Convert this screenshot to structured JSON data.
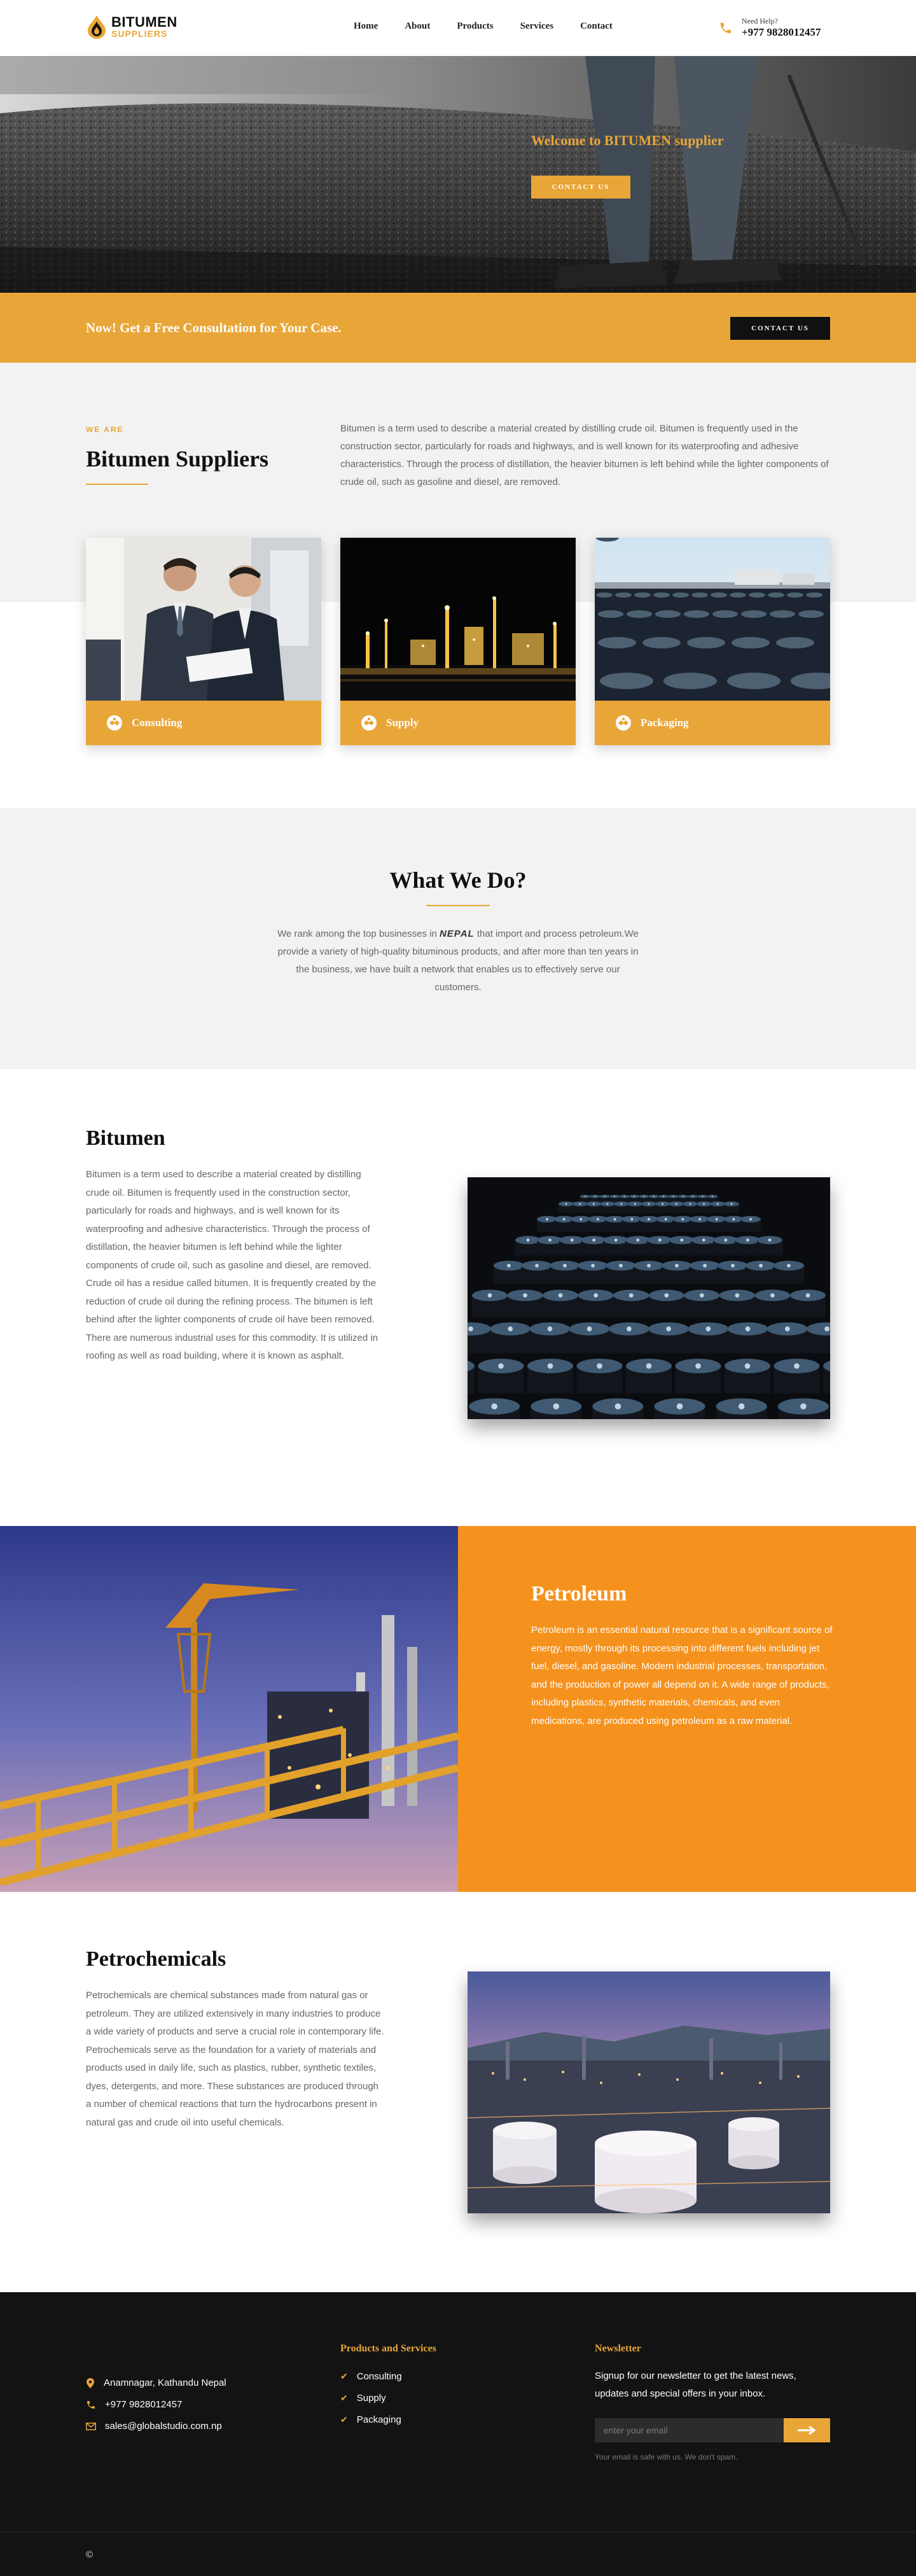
{
  "header": {
    "logo_main": "BITUMEN",
    "logo_sub": "SUPPLIERS",
    "nav": [
      "Home",
      "About",
      "Products",
      "Services",
      "Contact"
    ],
    "help_label": "Need Help?",
    "help_phone": "+977 9828012457"
  },
  "hero": {
    "title": "Welcome to BITUMEN supplier",
    "button": "CONTACT US"
  },
  "band": {
    "text": "Now! Get a Free Consultation for Your Case.",
    "button": "CONTACT US"
  },
  "about": {
    "eyebrow": "WE ARE",
    "title": "Bitumen Suppliers",
    "text": "Bitumen is a term used to describe a material created by distilling crude oil. Bitumen is frequently used in the construction sector, particularly for roads and highways, and is well known for its waterproofing and adhesive characteristics. Through the process of distillation, the heavier bitumen is left behind while the lighter components of crude oil, such as gasoline and diesel, are removed."
  },
  "cards": [
    {
      "label": "Consulting",
      "icon": "handshake-icon"
    },
    {
      "label": "Supply",
      "icon": "handshake-icon"
    },
    {
      "label": "Packaging",
      "icon": "handshake-icon"
    }
  ],
  "what": {
    "title": "What We Do?",
    "text_before": "We rank among the top businesses in ",
    "highlight": "NEPAL",
    "text_after": " that import and process petroleum.We provide a variety of high-quality bituminous products, and after more than ten years in the business, we have built a network that enables us to effectively serve our customers."
  },
  "bitumen": {
    "title": "Bitumen",
    "text": "Bitumen is a term used to describe a material created by distilling crude oil. Bitumen is frequently used in the construction sector, particularly for roads and highways, and is well known for its waterproofing and adhesive characteristics. Through the process of distillation, the heavier bitumen is left behind while the lighter components of crude oil, such as gasoline and diesel, are removed. Crude oil has a residue called bitumen. It is frequently created by the reduction of crude oil during the refining process. The bitumen is left behind after the lighter components of crude oil have been removed. There are numerous industrial uses for this commodity. It is utilized in roofing as well as road building, where it is known as asphalt."
  },
  "petroleum": {
    "title": "Petroleum",
    "text": "Petroleum is an essential natural resource that is a significant source of energy, mostly through its processing into different fuels including jet fuel, diesel, and gasoline. Modern industrial processes, transportation, and the production of power all depend on it. A wide range of products, including plastics, synthetic materials, chemicals, and even medications, are produced using petroleum as a raw material."
  },
  "petrochemicals": {
    "title": "Petrochemicals",
    "text": "Petrochemicals are chemical substances made from natural gas or petroleum. They are utilized extensively in many industries to produce a wide variety of products and serve a crucial role in contemporary life. Petrochemicals serve as the foundation for a variety of materials and products used in daily life, such as plastics, rubber, synthetic textiles, dyes, detergents, and more. These substances are produced through a number of chemical reactions that turn the hydrocarbons present in natural gas and crude oil into useful chemicals."
  },
  "footer": {
    "address": "Anamnagar, Kathandu Nepal",
    "phone": "+977 9828012457",
    "email": "sales@globalstudio.com.np",
    "products_heading": "Products and Services",
    "products": [
      "Consulting",
      "Supply",
      "Packaging"
    ],
    "newsletter_heading": "Newsletter",
    "newsletter_text": "Signup for our newsletter to get the latest news, updates and special offers in your inbox.",
    "newsletter_placeholder": "enter your email",
    "newsletter_note": "Your email is safe with us. We don't spam.",
    "copyright": "©"
  },
  "colors": {
    "accent": "#e9a638",
    "petroleum_bg": "#f5921e",
    "footer_bg": "#131313",
    "light_bg": "#f2f2f2"
  }
}
